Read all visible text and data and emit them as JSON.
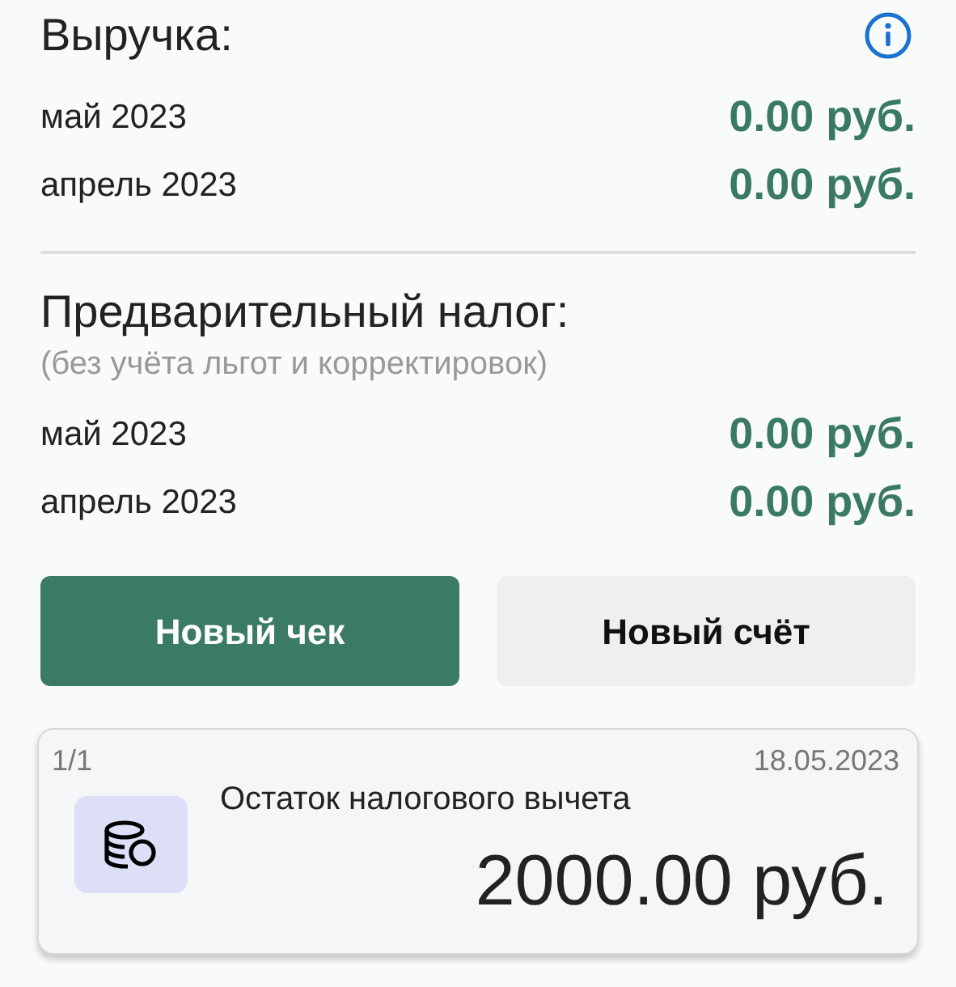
{
  "revenue": {
    "title": "Выручка:",
    "rows": [
      {
        "period": "май 2023",
        "amount": "0.00 руб."
      },
      {
        "period": "апрель 2023",
        "amount": "0.00 руб."
      }
    ]
  },
  "tax": {
    "title": "Предварительный налог:",
    "subtitle": "(без учёта льгот и корректировок)",
    "rows": [
      {
        "period": "май 2023",
        "amount": "0.00 руб."
      },
      {
        "period": "апрель 2023",
        "amount": "0.00 руб."
      }
    ]
  },
  "buttons": [
    {
      "label": "Новый чек",
      "kind": "primary"
    },
    {
      "label": "Новый счёт",
      "kind": "secondary"
    }
  ],
  "card": {
    "counter": "1/1",
    "date": "18.05.2023",
    "title": "Остаток налогового вычета",
    "amount": "2000.00 руб."
  }
}
